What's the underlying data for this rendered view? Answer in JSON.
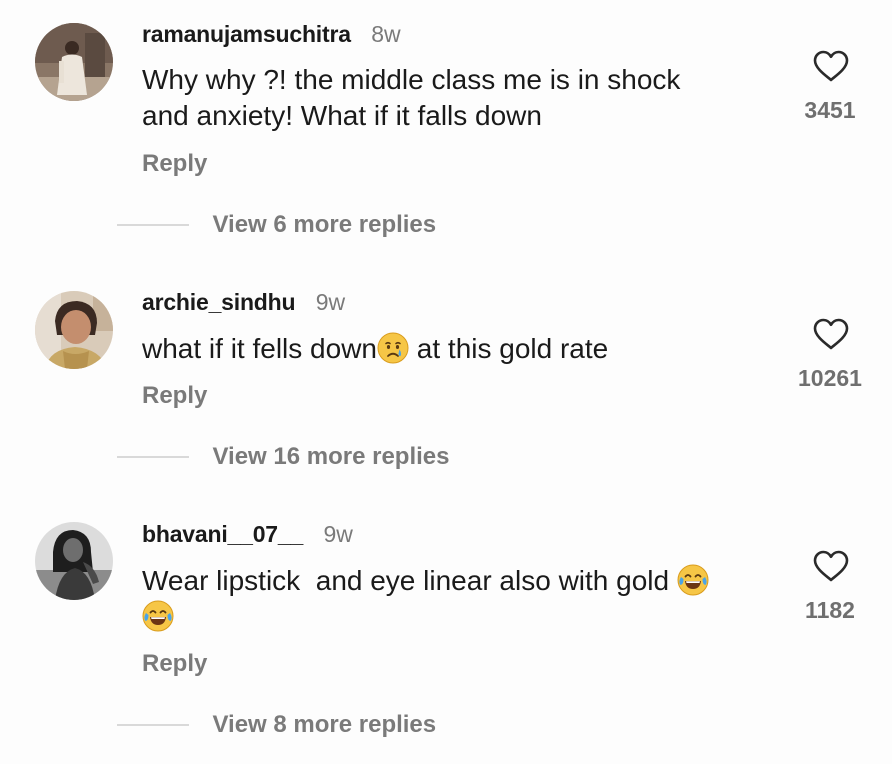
{
  "comments": [
    {
      "username": "ramanujamsuchitra",
      "time": "8w",
      "text_lines": [
        "Why why ?! the middle class me is in shock",
        "and anxiety! What if it falls down"
      ],
      "reply_label": "Reply",
      "likes": "3451",
      "view_more": "View 6 more replies",
      "avatar_icon": "user-avatar"
    },
    {
      "username": "archie_sindhu",
      "time": "9w",
      "text_before_emoji": "what if it fells down",
      "emoji": "crying-face-emoji",
      "text_after_emoji": " at this gold rate",
      "reply_label": "Reply",
      "likes": "10261",
      "view_more": "View 16 more replies",
      "avatar_icon": "user-avatar"
    },
    {
      "username": "bhavani__07__",
      "time": "9w",
      "text_line1": "Wear lipstick  and eye linear also with gold ",
      "emoji": "tears-of-joy-emoji",
      "reply_label": "Reply",
      "likes": "1182",
      "view_more": "View 8 more replies",
      "avatar_icon": "user-avatar"
    }
  ],
  "colors": {
    "text": "#1a1a1a",
    "muted": "#7a7a7a",
    "divider": "#d9d9d9",
    "background": "#fdfdfd"
  }
}
